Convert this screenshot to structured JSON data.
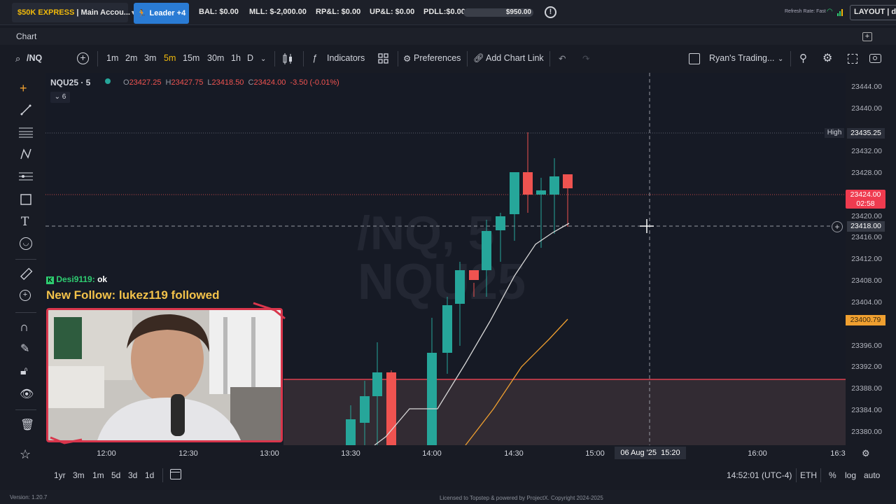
{
  "topbar": {
    "account_prefix": "$50K EXPRESS",
    "account_name": "| Main Accou...",
    "leader_label": "Leader +4",
    "bal": "BAL: $0.00",
    "mll": "MLL: $-2,000.00",
    "rpl": "RP&L: $0.00",
    "upl": "UP&L: $0.00",
    "pdll": "PDLL:$0.00",
    "pdll_bar_value": "$950.00",
    "refresh_rate": "Refresh Rate: Fast",
    "layout_label": "LAYOUT | de"
  },
  "panel": {
    "tab_label": "Chart"
  },
  "toolbar": {
    "symbol": "/NQ",
    "intervals": [
      "1m",
      "2m",
      "3m",
      "5m",
      "15m",
      "30m",
      "1h",
      "D"
    ],
    "active_interval": "5m",
    "indicators_label": "Indicators",
    "preferences_label": "Preferences",
    "add_chart_link_label": "Add Chart Link",
    "template_label": "Ryan's Trading..."
  },
  "legend": {
    "symbol": "NQU25 · 5",
    "open": "23427.25",
    "high": "23427.75",
    "low": "23418.50",
    "close": "23424.00",
    "change": "-3.50 (-0.01%)",
    "collapse_count": "6",
    "watermark_line1": "/NQ, 5",
    "watermark_line2": "NQU25"
  },
  "price_scale": {
    "ticks": [
      "23444.00",
      "23440.00",
      "23432.00",
      "23428.00",
      "23420.00",
      "23416.00",
      "23412.00",
      "23408.00",
      "23404.00",
      "23396.00",
      "23392.00",
      "23388.00",
      "23384.00",
      "23380.00"
    ],
    "high_label": "High",
    "high_value": "23435.25",
    "current_price": "23424.00",
    "countdown": "02:58",
    "crosshair_price": "23418.00",
    "ema_price": "23400.79"
  },
  "time_scale": {
    "ticks": [
      "12:00",
      "12:30",
      "13:00",
      "13:30",
      "14:00",
      "14:30",
      "15:00",
      "16:00",
      "16:3"
    ],
    "crosshair_label": "06 Aug '25",
    "crosshair_time": "15:20"
  },
  "bottombar": {
    "ranges": [
      "1yr",
      "3m",
      "1m",
      "5d",
      "3d",
      "1d"
    ],
    "clock": "14:52:01 (UTC-4)",
    "session": "ETH",
    "pct": "%",
    "log": "log",
    "auto": "auto"
  },
  "overlay": {
    "chat_user": "Desi9119:",
    "chat_message": "ok",
    "follow_alert": "New Follow: lukez119 followed"
  },
  "footer": {
    "version": "Version: 1.20.7",
    "license": "Licensed to Topstep & powered by ProjectX. Copyright 2024-2025"
  },
  "colors": {
    "up": "#26a69a",
    "down": "#ef5350",
    "accent": "#2a7bd4",
    "ema_fast": "#d8d8d8",
    "ema_slow": "#f0a030",
    "sl_zone": "#4a3a3f"
  }
}
